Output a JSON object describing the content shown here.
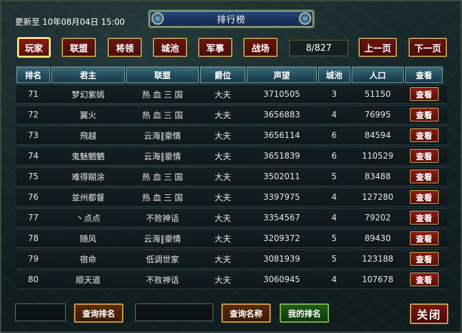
{
  "header": {
    "update_time": "更新至 10年08月04日 15:00",
    "title": "排行榜"
  },
  "tabs": [
    {
      "label": "玩家",
      "active": true
    },
    {
      "label": "联盟",
      "active": false
    },
    {
      "label": "将领",
      "active": false
    },
    {
      "label": "城池",
      "active": false
    },
    {
      "label": "军事",
      "active": false
    },
    {
      "label": "战场",
      "active": false
    }
  ],
  "pagination": {
    "page_display": "8/827",
    "prev_label": "上一页",
    "next_label": "下一页"
  },
  "table": {
    "columns": [
      "排名",
      "君主",
      "联盟",
      "爵位",
      "声望",
      "城池",
      "人口",
      "查看"
    ],
    "view_label": "查看",
    "rows": [
      {
        "rank": "71",
        "lord": "梦幻紫嫣",
        "alliance": "热 血 三 国",
        "title": "大夫",
        "fame": "3710505",
        "cities": "3",
        "population": "51150"
      },
      {
        "rank": "72",
        "lord": "翼火",
        "alliance": "热 血 三 国",
        "title": "大夫",
        "fame": "3656883",
        "cities": "4",
        "population": "76995"
      },
      {
        "rank": "73",
        "lord": "飛越",
        "alliance": "云海‖豪情",
        "title": "大夫",
        "fame": "3656114",
        "cities": "6",
        "population": "84594"
      },
      {
        "rank": "74",
        "lord": "鬼魅魍魉",
        "alliance": "云海‖豪情",
        "title": "大夫",
        "fame": "3651839",
        "cities": "6",
        "population": "110529"
      },
      {
        "rank": "75",
        "lord": "难得糊涂",
        "alliance": "热 血 三 国",
        "title": "大夫",
        "fame": "3502011",
        "cities": "5",
        "population": "83488"
      },
      {
        "rank": "76",
        "lord": "並州都督",
        "alliance": "热 血 三 国",
        "title": "大夫",
        "fame": "3397975",
        "cities": "4",
        "population": "127280"
      },
      {
        "rank": "77",
        "lord": "丶点点",
        "alliance": "不败神话",
        "title": "大夫",
        "fame": "3354567",
        "cities": "4",
        "population": "79202"
      },
      {
        "rank": "78",
        "lord": "随风",
        "alliance": "云海‖豪情",
        "title": "大夫",
        "fame": "3209372",
        "cities": "5",
        "population": "89430"
      },
      {
        "rank": "79",
        "lord": "宿命",
        "alliance": "低调世家",
        "title": "大夫",
        "fame": "3081939",
        "cities": "5",
        "population": "123188"
      },
      {
        "rank": "80",
        "lord": "顺天道",
        "alliance": "不败神话",
        "title": "大夫",
        "fame": "3060945",
        "cities": "4",
        "population": "107678"
      }
    ]
  },
  "footer": {
    "rank_input_value": "",
    "search_rank_label": "查询排名",
    "name_input_value": "",
    "search_name_label": "查询名称",
    "my_rank_label": "我的排名",
    "close_label": "关闭"
  }
}
